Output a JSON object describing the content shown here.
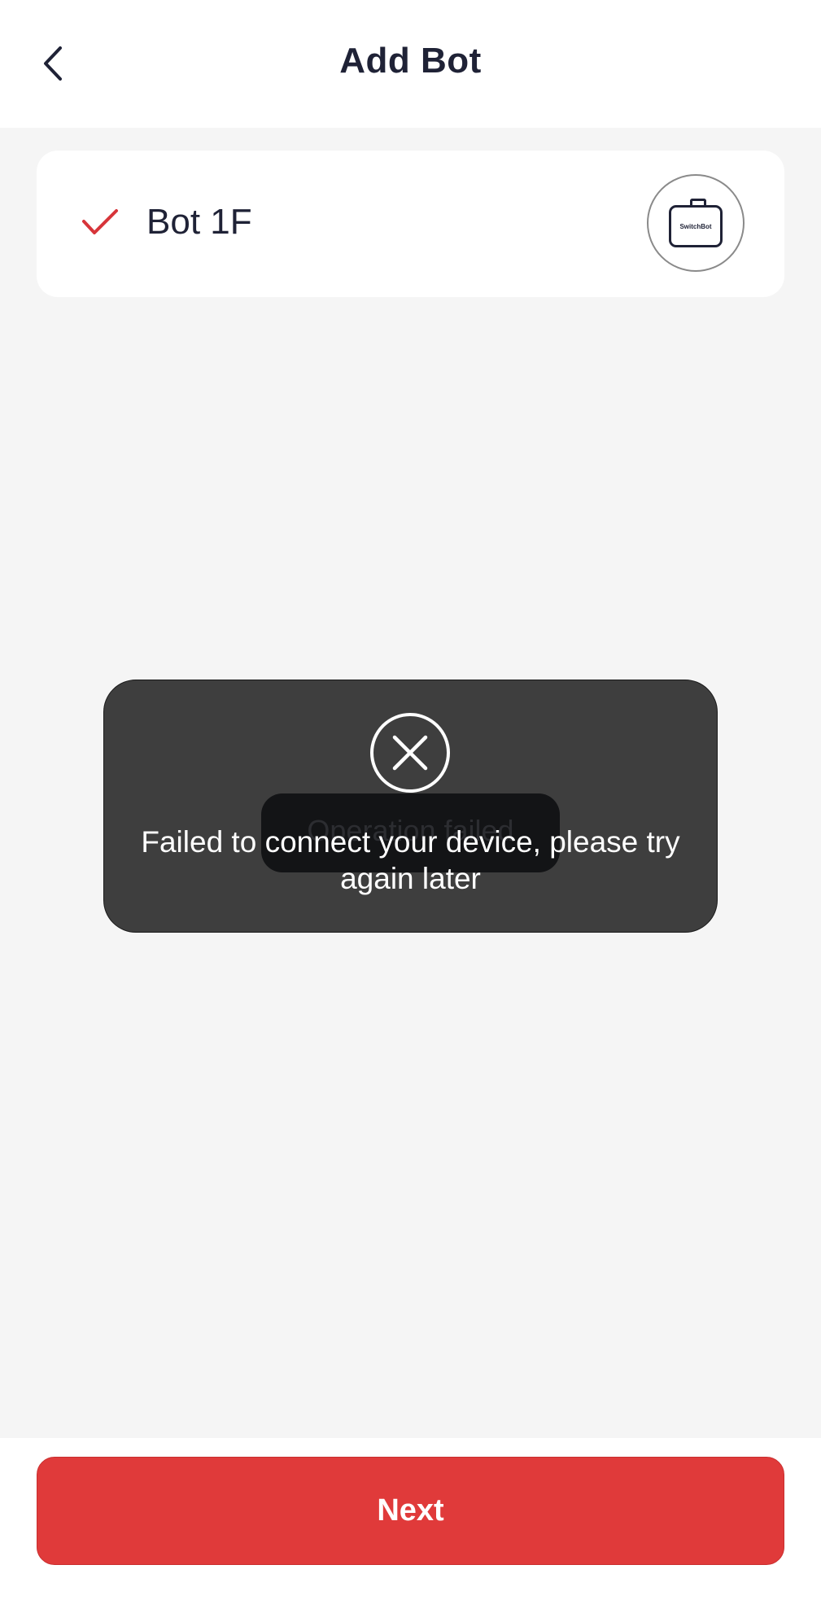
{
  "header": {
    "title": "Add Bot",
    "back_icon": "chevron-left-icon"
  },
  "device": {
    "name": "Bot 1F",
    "selected": true,
    "check_icon": "checkmark-icon",
    "image_icon": "switchbot-device-icon",
    "brand_label": "SwitchBot"
  },
  "toast": {
    "icon": "close-circle-icon",
    "message": "Failed to connect your device, please try again later",
    "background_message": "Operation failed"
  },
  "footer": {
    "next_label": "Next"
  },
  "colors": {
    "accent": "#e03a3a",
    "text": "#1f2236",
    "background": "#f5f5f5",
    "toast": "#3e3e3e"
  }
}
